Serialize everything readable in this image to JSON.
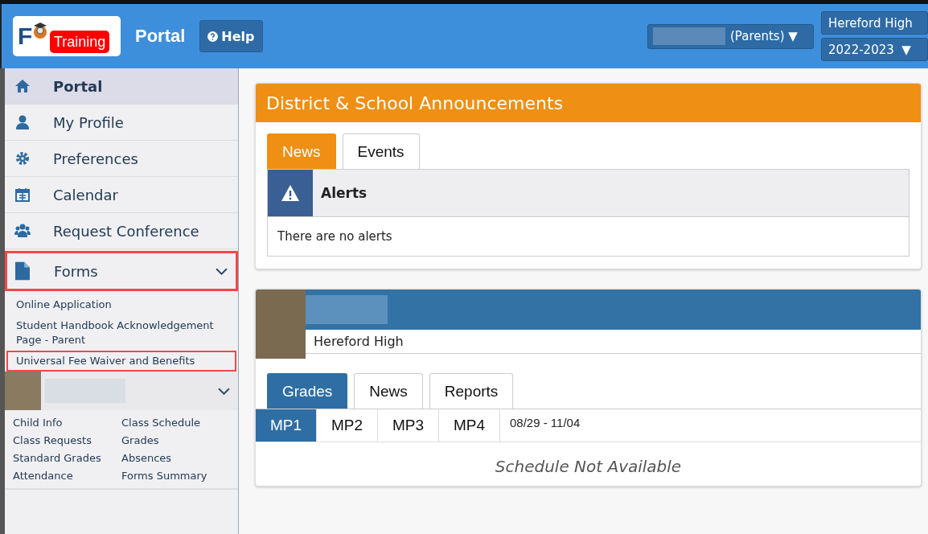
{
  "header": {
    "logo_letter": "F",
    "logo_badge": "Training",
    "title": "Portal",
    "help_button": "Help",
    "user_menu": "(Parents) ▼",
    "school_menu": "Hereford High",
    "year_menu": "2022-2023  ▼"
  },
  "sidebar": {
    "items": [
      {
        "label": "Portal",
        "kind": "home",
        "selected": true
      },
      {
        "label": "My Profile",
        "kind": "user",
        "selected": false
      },
      {
        "label": "Preferences",
        "kind": "gear",
        "selected": false
      },
      {
        "label": "Calendar",
        "kind": "calendar",
        "selected": false
      },
      {
        "label": "Request Conference",
        "kind": "users",
        "selected": false
      }
    ],
    "forms": {
      "label": "Forms",
      "highlighted": true,
      "expanded": true,
      "children": [
        {
          "label": "Online Application",
          "highlighted": false
        },
        {
          "label": "Student Handbook Acknowledgement Page - Parent",
          "highlighted": false
        },
        {
          "label": "Universal Fee Waiver and Benefits",
          "highlighted": true
        }
      ]
    },
    "student": {
      "expanded": true,
      "links": [
        "Child Info",
        "Class Schedule",
        "Class Requests",
        "Grades",
        "Standard Grades",
        "Absences",
        "Attendance",
        "Forms Summary"
      ]
    }
  },
  "announcements": {
    "title": "District & School Announcements",
    "tabs": [
      {
        "label": "News",
        "selected": true
      },
      {
        "label": "Events",
        "selected": false
      }
    ],
    "alerts_title": "Alerts",
    "alerts_text": "There are no alerts"
  },
  "student_card": {
    "school": "Hereford High",
    "tabs": [
      {
        "label": "Grades",
        "selected": true
      },
      {
        "label": "News",
        "selected": false
      },
      {
        "label": "Reports",
        "selected": false
      }
    ],
    "periods": [
      {
        "label": "MP1",
        "selected": true
      },
      {
        "label": "MP2",
        "selected": false
      },
      {
        "label": "MP3",
        "selected": false
      },
      {
        "label": "MP4",
        "selected": false
      }
    ],
    "date_range": "08/29 - 11/04",
    "empty_text": "Schedule Not Available"
  }
}
